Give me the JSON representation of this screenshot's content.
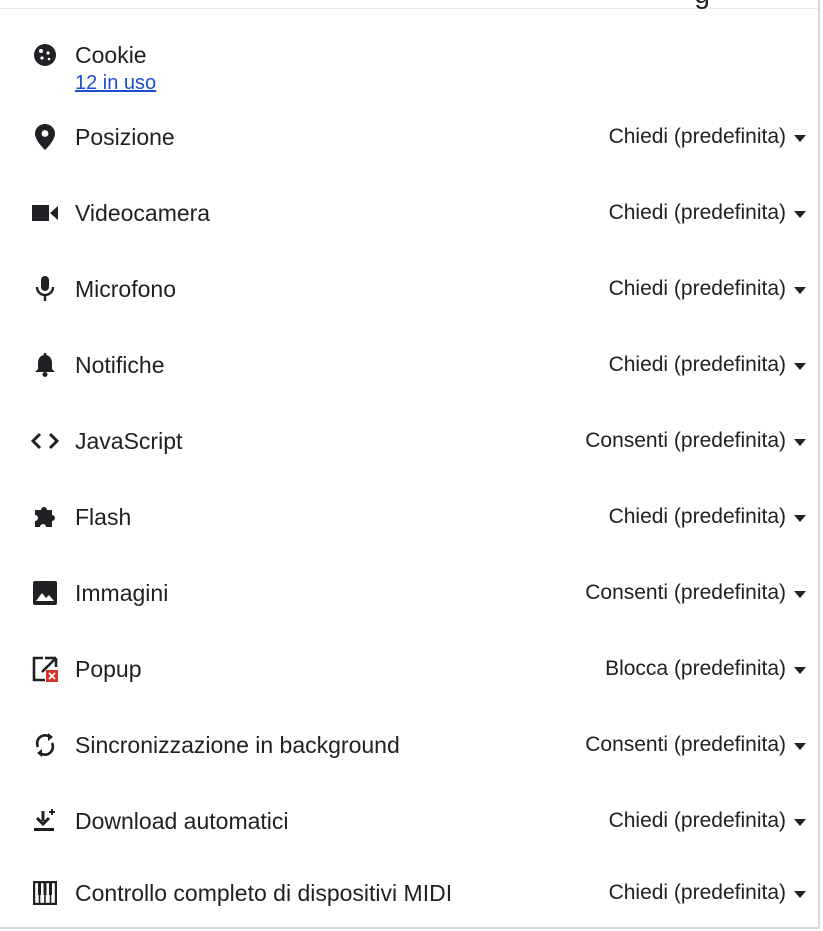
{
  "top_clip_text": "g",
  "cookie": {
    "label": "Cookie",
    "sub": "12 in uso"
  },
  "permissions": [
    {
      "label": "Posizione",
      "value": "Chiedi (predefinita)",
      "icon": "location-pin-icon"
    },
    {
      "label": "Videocamera",
      "value": "Chiedi (predefinita)",
      "icon": "videocam-icon"
    },
    {
      "label": "Microfono",
      "value": "Chiedi (predefinita)",
      "icon": "microphone-icon"
    },
    {
      "label": "Notifiche",
      "value": "Chiedi (predefinita)",
      "icon": "bell-icon"
    },
    {
      "label": "JavaScript",
      "value": "Consenti (predefinita)",
      "icon": "code-icon"
    },
    {
      "label": "Flash",
      "value": "Chiedi (predefinita)",
      "icon": "puzzle-icon"
    },
    {
      "label": "Immagini",
      "value": "Consenti (predefinita)",
      "icon": "image-icon"
    },
    {
      "label": "Popup",
      "value": "Blocca (predefinita)",
      "icon": "popup-blocked-icon"
    },
    {
      "label": "Sincronizzazione in background",
      "value": "Consenti (predefinita)",
      "icon": "sync-icon"
    },
    {
      "label": "Download automatici",
      "value": "Chiedi (predefinita)",
      "icon": "download-icon"
    },
    {
      "label": "Controllo completo di dispositivi MIDI",
      "value": "Chiedi (predefinita)",
      "icon": "midi-piano-icon"
    }
  ],
  "colors": {
    "text": "#202124",
    "link": "#1a4fcf",
    "popup_badge": "#d93025"
  }
}
